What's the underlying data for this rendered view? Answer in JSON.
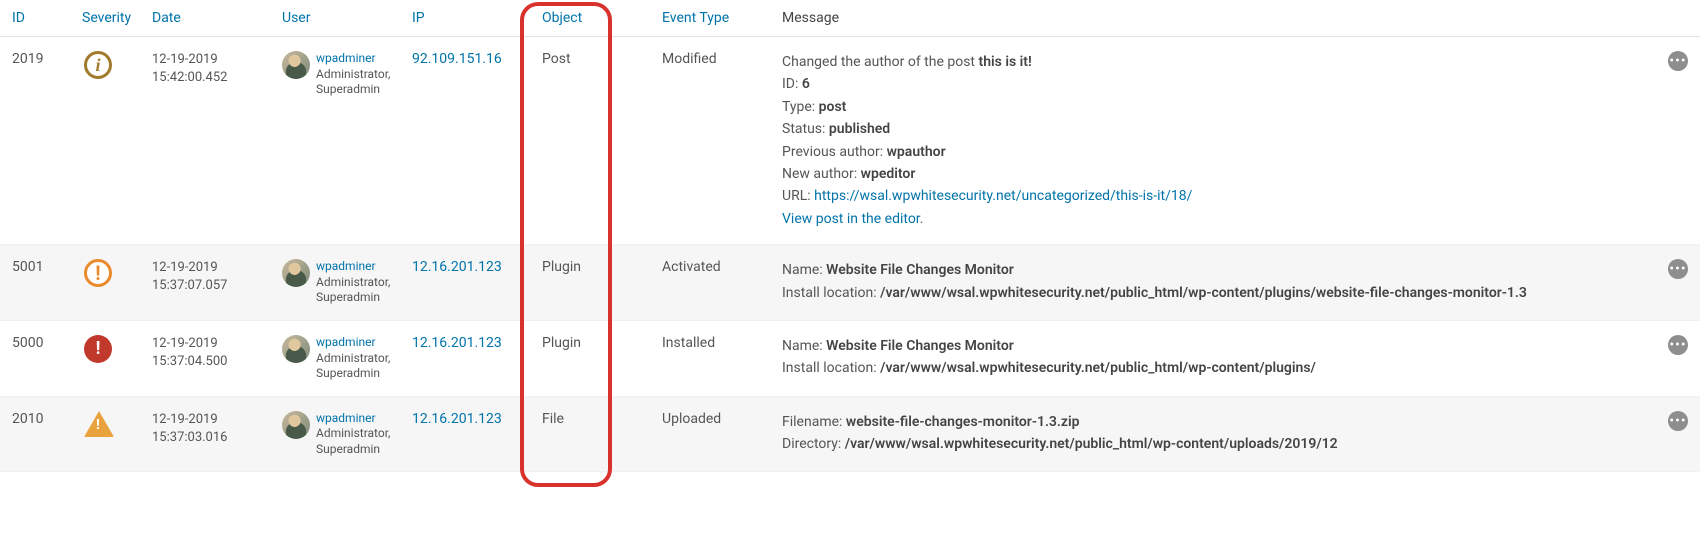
{
  "columns": {
    "id": "ID",
    "severity": "Severity",
    "date": "Date",
    "user": "User",
    "ip": "IP",
    "object": "Object",
    "event_type": "Event Type",
    "message": "Message"
  },
  "rows": [
    {
      "id": "2019",
      "severity": "info",
      "date_line1": "12-19-2019",
      "date_line2": "15:42:00.452",
      "user_name": "wpadminer",
      "user_role1": "Administrator,",
      "user_role2": "Superadmin",
      "ip": "92.109.151.16",
      "object": "Post",
      "event_type": "Modified",
      "message": {
        "line1_pre": "Changed the author of the post ",
        "line1_bold": "this is it!",
        "id_label": "ID: ",
        "id_val": "6",
        "type_label": "Type: ",
        "type_val": "post",
        "status_label": "Status: ",
        "status_val": "published",
        "prev_label": "Previous author: ",
        "prev_val": "wpauthor",
        "new_label": "New author: ",
        "new_val": "wpeditor",
        "url_label": "URL: ",
        "url_val": "https://wsal.wpwhitesecurity.net/uncategorized/this-is-it/18/",
        "view_link": "View post in the editor"
      }
    },
    {
      "id": "5001",
      "severity": "high",
      "date_line1": "12-19-2019",
      "date_line2": "15:37:07.057",
      "user_name": "wpadminer",
      "user_role1": "Administrator,",
      "user_role2": "Superadmin",
      "ip": "12.16.201.123",
      "object": "Plugin",
      "event_type": "Activated",
      "message": {
        "name_label": "Name: ",
        "name_val": "Website File Changes Monitor",
        "loc_label": "Install location: ",
        "loc_val": "/var/www/wsal.wpwhitesecurity.net/public_html/wp-content/plugins/website-file-changes-monitor-1.3"
      }
    },
    {
      "id": "5000",
      "severity": "critical",
      "date_line1": "12-19-2019",
      "date_line2": "15:37:04.500",
      "user_name": "wpadminer",
      "user_role1": "Administrator,",
      "user_role2": "Superadmin",
      "ip": "12.16.201.123",
      "object": "Plugin",
      "event_type": "Installed",
      "message": {
        "name_label": "Name: ",
        "name_val": "Website File Changes Monitor",
        "loc_label": "Install location: ",
        "loc_val": "/var/www/wsal.wpwhitesecurity.net/public_html/wp-content/plugins/"
      }
    },
    {
      "id": "2010",
      "severity": "warning",
      "date_line1": "12-19-2019",
      "date_line2": "15:37:03.016",
      "user_name": "wpadminer",
      "user_role1": "Administrator,",
      "user_role2": "Superadmin",
      "ip": "12.16.201.123",
      "object": "File",
      "event_type": "Uploaded",
      "message": {
        "file_label": "Filename: ",
        "file_val": "website-file-changes-monitor-1.3.zip",
        "dir_label": "Directory: ",
        "dir_val": "/var/www/wsal.wpwhitesecurity.net/public_html/wp-content/uploads/2019/12"
      }
    }
  ]
}
